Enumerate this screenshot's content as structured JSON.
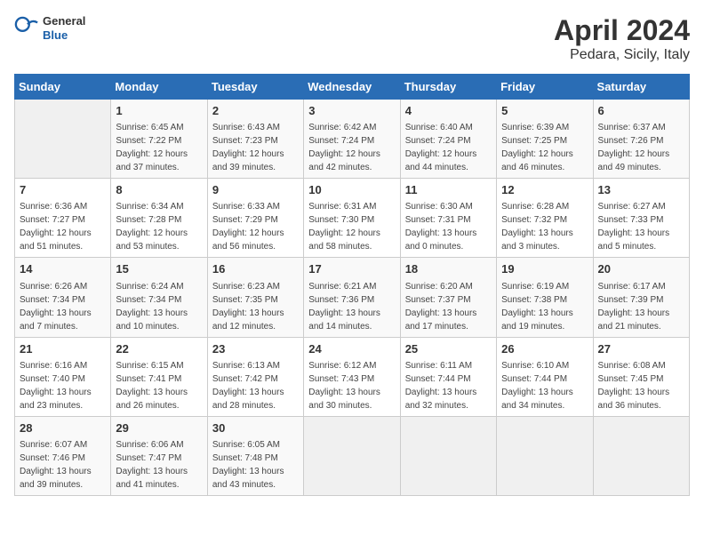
{
  "header": {
    "logo_general": "General",
    "logo_blue": "Blue",
    "title": "April 2024",
    "subtitle": "Pedara, Sicily, Italy"
  },
  "days_of_week": [
    "Sunday",
    "Monday",
    "Tuesday",
    "Wednesday",
    "Thursday",
    "Friday",
    "Saturday"
  ],
  "weeks": [
    [
      {
        "day": "",
        "info": ""
      },
      {
        "day": "1",
        "info": "Sunrise: 6:45 AM\nSunset: 7:22 PM\nDaylight: 12 hours\nand 37 minutes."
      },
      {
        "day": "2",
        "info": "Sunrise: 6:43 AM\nSunset: 7:23 PM\nDaylight: 12 hours\nand 39 minutes."
      },
      {
        "day": "3",
        "info": "Sunrise: 6:42 AM\nSunset: 7:24 PM\nDaylight: 12 hours\nand 42 minutes."
      },
      {
        "day": "4",
        "info": "Sunrise: 6:40 AM\nSunset: 7:24 PM\nDaylight: 12 hours\nand 44 minutes."
      },
      {
        "day": "5",
        "info": "Sunrise: 6:39 AM\nSunset: 7:25 PM\nDaylight: 12 hours\nand 46 minutes."
      },
      {
        "day": "6",
        "info": "Sunrise: 6:37 AM\nSunset: 7:26 PM\nDaylight: 12 hours\nand 49 minutes."
      }
    ],
    [
      {
        "day": "7",
        "info": "Sunrise: 6:36 AM\nSunset: 7:27 PM\nDaylight: 12 hours\nand 51 minutes."
      },
      {
        "day": "8",
        "info": "Sunrise: 6:34 AM\nSunset: 7:28 PM\nDaylight: 12 hours\nand 53 minutes."
      },
      {
        "day": "9",
        "info": "Sunrise: 6:33 AM\nSunset: 7:29 PM\nDaylight: 12 hours\nand 56 minutes."
      },
      {
        "day": "10",
        "info": "Sunrise: 6:31 AM\nSunset: 7:30 PM\nDaylight: 12 hours\nand 58 minutes."
      },
      {
        "day": "11",
        "info": "Sunrise: 6:30 AM\nSunset: 7:31 PM\nDaylight: 13 hours\nand 0 minutes."
      },
      {
        "day": "12",
        "info": "Sunrise: 6:28 AM\nSunset: 7:32 PM\nDaylight: 13 hours\nand 3 minutes."
      },
      {
        "day": "13",
        "info": "Sunrise: 6:27 AM\nSunset: 7:33 PM\nDaylight: 13 hours\nand 5 minutes."
      }
    ],
    [
      {
        "day": "14",
        "info": "Sunrise: 6:26 AM\nSunset: 7:34 PM\nDaylight: 13 hours\nand 7 minutes."
      },
      {
        "day": "15",
        "info": "Sunrise: 6:24 AM\nSunset: 7:34 PM\nDaylight: 13 hours\nand 10 minutes."
      },
      {
        "day": "16",
        "info": "Sunrise: 6:23 AM\nSunset: 7:35 PM\nDaylight: 13 hours\nand 12 minutes."
      },
      {
        "day": "17",
        "info": "Sunrise: 6:21 AM\nSunset: 7:36 PM\nDaylight: 13 hours\nand 14 minutes."
      },
      {
        "day": "18",
        "info": "Sunrise: 6:20 AM\nSunset: 7:37 PM\nDaylight: 13 hours\nand 17 minutes."
      },
      {
        "day": "19",
        "info": "Sunrise: 6:19 AM\nSunset: 7:38 PM\nDaylight: 13 hours\nand 19 minutes."
      },
      {
        "day": "20",
        "info": "Sunrise: 6:17 AM\nSunset: 7:39 PM\nDaylight: 13 hours\nand 21 minutes."
      }
    ],
    [
      {
        "day": "21",
        "info": "Sunrise: 6:16 AM\nSunset: 7:40 PM\nDaylight: 13 hours\nand 23 minutes."
      },
      {
        "day": "22",
        "info": "Sunrise: 6:15 AM\nSunset: 7:41 PM\nDaylight: 13 hours\nand 26 minutes."
      },
      {
        "day": "23",
        "info": "Sunrise: 6:13 AM\nSunset: 7:42 PM\nDaylight: 13 hours\nand 28 minutes."
      },
      {
        "day": "24",
        "info": "Sunrise: 6:12 AM\nSunset: 7:43 PM\nDaylight: 13 hours\nand 30 minutes."
      },
      {
        "day": "25",
        "info": "Sunrise: 6:11 AM\nSunset: 7:44 PM\nDaylight: 13 hours\nand 32 minutes."
      },
      {
        "day": "26",
        "info": "Sunrise: 6:10 AM\nSunset: 7:44 PM\nDaylight: 13 hours\nand 34 minutes."
      },
      {
        "day": "27",
        "info": "Sunrise: 6:08 AM\nSunset: 7:45 PM\nDaylight: 13 hours\nand 36 minutes."
      }
    ],
    [
      {
        "day": "28",
        "info": "Sunrise: 6:07 AM\nSunset: 7:46 PM\nDaylight: 13 hours\nand 39 minutes."
      },
      {
        "day": "29",
        "info": "Sunrise: 6:06 AM\nSunset: 7:47 PM\nDaylight: 13 hours\nand 41 minutes."
      },
      {
        "day": "30",
        "info": "Sunrise: 6:05 AM\nSunset: 7:48 PM\nDaylight: 13 hours\nand 43 minutes."
      },
      {
        "day": "",
        "info": ""
      },
      {
        "day": "",
        "info": ""
      },
      {
        "day": "",
        "info": ""
      },
      {
        "day": "",
        "info": ""
      }
    ]
  ]
}
